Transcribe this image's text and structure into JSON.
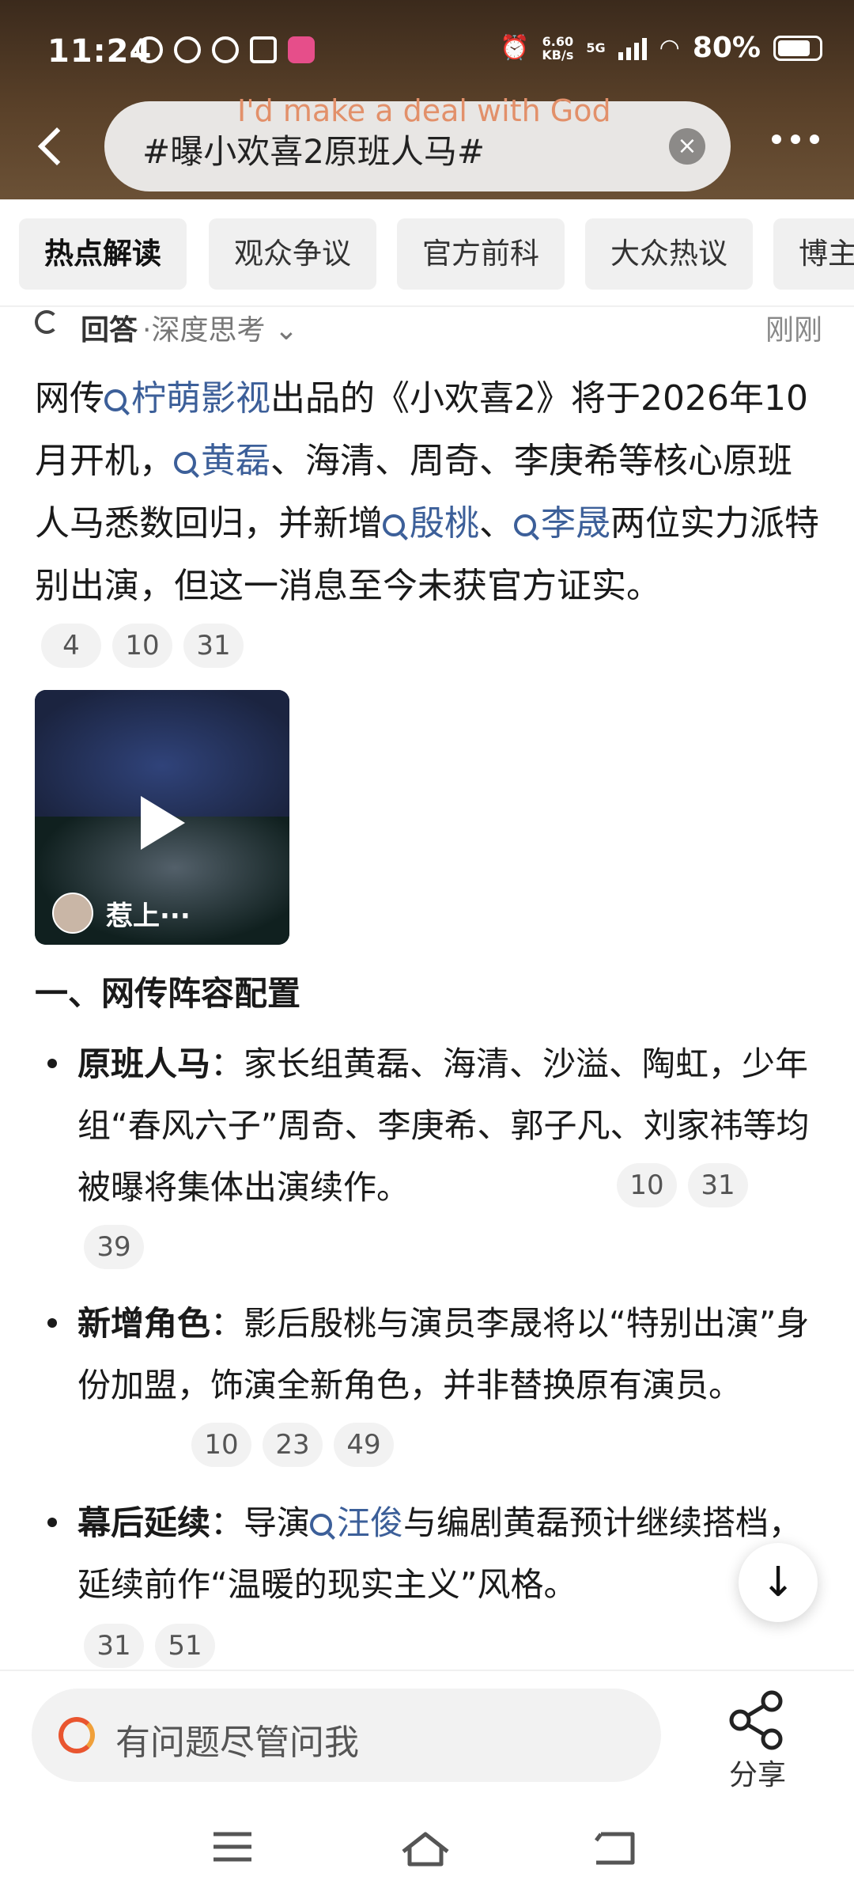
{
  "status_bar": {
    "time": "11:24",
    "net_speed_value": "6.60",
    "net_speed_unit": "KB/s",
    "network": "5G",
    "battery": "80%",
    "battery_level": 0.8
  },
  "search": {
    "query": "#曝小欢喜2原班人马#",
    "overlay_text": "I'd make a deal with God"
  },
  "chips": [
    "热点解读",
    "观众争议",
    "官方前科",
    "大众热议",
    "博主"
  ],
  "answer": {
    "label": "回答",
    "mode": "·深度思考",
    "time": "刚刚"
  },
  "paragraph": {
    "t1": "网传",
    "link1": "柠萌影视",
    "t2": "出品的《小欢喜2》将于2026年10月开机，",
    "link2": "黄磊",
    "t3": "、海清、周奇、李庚希等核心原班人马悉数回归，并新增",
    "link3": "殷桃",
    "t4": "、",
    "link4": "李晟",
    "t5": "两位实力派特别出演，但这一消息至今未获官方证实。",
    "refs": [
      "4",
      "10",
      "31"
    ]
  },
  "video": {
    "title": "惹上···"
  },
  "section": {
    "title": "一、网传阵容配置"
  },
  "bullets": [
    {
      "head": "原班人马",
      "text": "：家长组黄磊、海清、沙溢、陶虹，少年组“春风六子”周奇、李庚希、郭子凡、刘家祎等均被曝将集体出演续作。",
      "refs": [
        "10",
        "31",
        "39"
      ]
    },
    {
      "head": "新增角色",
      "text": "：影后殷桃与演员李晟将以“特别出演”身份加盟，饰演全新角色，并非替换原有演员。",
      "refs": [
        "10",
        "23",
        "49"
      ]
    },
    {
      "head": "幕后延续",
      "text_a": "：导演",
      "link": "汪俊",
      "text_b": "与编剧黄磊预计继续搭档，延续前作“温暖的现实主义”风格。",
      "refs": [
        "31",
        "51"
      ]
    }
  ],
  "bottom": {
    "ask_placeholder": "有问题尽管问我",
    "share_label": "分享"
  },
  "nav": [
    "menu-icon",
    "home-icon",
    "back-icon"
  ]
}
